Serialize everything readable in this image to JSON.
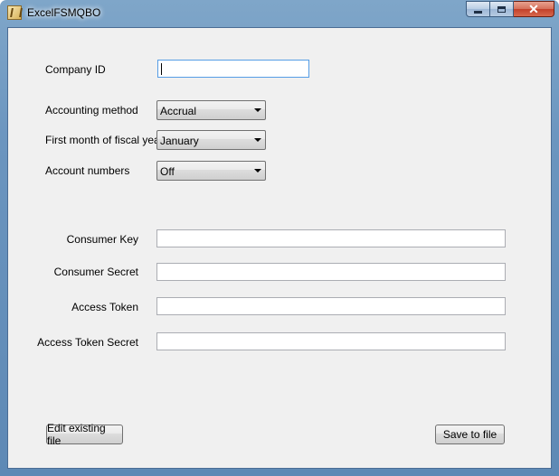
{
  "window": {
    "title": "ExcelFSMQBO"
  },
  "titlebar_buttons": {
    "minimize": "minimize",
    "maximize": "maximize",
    "close": "close"
  },
  "form": {
    "company_id_label": "Company ID",
    "company_id_value": "",
    "accounting_method_label": "Accounting method",
    "accounting_method_value": "Accrual",
    "fiscal_month_label": "First month of fiscal year",
    "fiscal_month_value": "January",
    "account_numbers_label": "Account numbers",
    "account_numbers_value": "Off",
    "consumer_key_label": "Consumer Key",
    "consumer_key_value": "",
    "consumer_secret_label": "Consumer Secret",
    "consumer_secret_value": "",
    "access_token_label": "Access Token",
    "access_token_value": "",
    "access_token_secret_label": "Access Token Secret",
    "access_token_secret_value": ""
  },
  "buttons": {
    "edit_existing": "Edit existing file",
    "save_to_file": "Save to file"
  }
}
